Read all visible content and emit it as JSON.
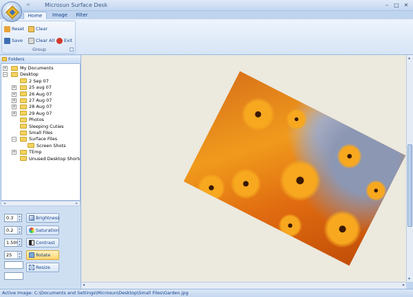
{
  "app": {
    "title": "Microsun Surface Desk",
    "qat_glyph": "="
  },
  "window_buttons": {
    "minimize": "–",
    "maximize": "□",
    "close": "✕"
  },
  "tabs": [
    {
      "label": "Home",
      "active": true
    },
    {
      "label": "Image",
      "active": false
    },
    {
      "label": "Filter",
      "active": false
    }
  ],
  "ribbon": {
    "group_label": "Group",
    "buttons": {
      "reset": "Reset",
      "clear": "Clear",
      "save": "Save",
      "clear_all": "Clear All",
      "exit": "Exit"
    }
  },
  "folders": {
    "header": "Folders",
    "items": [
      {
        "label": "My Documents",
        "expander": "+"
      },
      {
        "label": "Desktop",
        "expander": "−"
      },
      {
        "label": "2 Sep 07",
        "expander": ""
      },
      {
        "label": "25 aug 07",
        "expander": "+"
      },
      {
        "label": "26 Aug 07",
        "expander": "+"
      },
      {
        "label": "27 Aug 07",
        "expander": "+"
      },
      {
        "label": "28 Aug 07",
        "expander": "+"
      },
      {
        "label": "29 Aug 07",
        "expander": "+"
      },
      {
        "label": "Photos",
        "expander": ""
      },
      {
        "label": "Sleeping Cuties",
        "expander": ""
      },
      {
        "label": "Small Files",
        "expander": ""
      },
      {
        "label": "Surface Files",
        "expander": "−"
      },
      {
        "label": "Screen Shots",
        "expander": ""
      },
      {
        "label": "TEmp",
        "expander": "+"
      },
      {
        "label": "Unused Desktop Shortcuts",
        "expander": ""
      }
    ]
  },
  "adjustments": {
    "brightness": {
      "value": "0.3",
      "label": "Brightness"
    },
    "saturation": {
      "value": "0.2",
      "label": "Saturation"
    },
    "contrast": {
      "value": "1.500",
      "label": "Contrast"
    },
    "rotate": {
      "value": "25",
      "label": "Rotate"
    },
    "resize": {
      "label": "Resize"
    }
  },
  "scroll_glyphs": {
    "left": "◂",
    "right": "▸",
    "up": "▴",
    "down": "▾"
  },
  "status": {
    "text": "Active Image: C:\\Documents and Settings\\Microsun\\Desktop\\Small Files\\Garden.jpg"
  },
  "colors": {
    "accent": "#15428b",
    "canvas": "#ece9de",
    "ribbon": "#d7e5f7"
  }
}
